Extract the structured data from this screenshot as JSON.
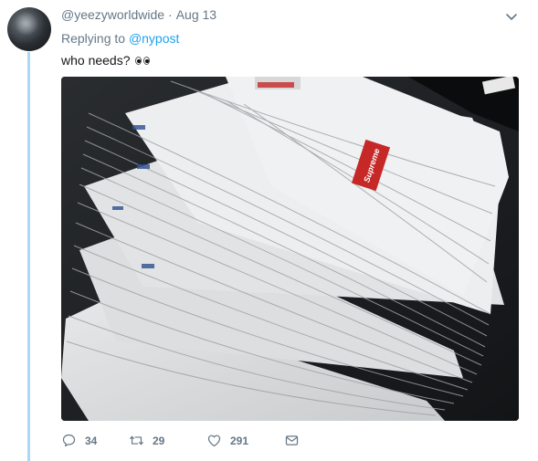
{
  "tweet": {
    "handle": "@yeezyworldwide",
    "separator": "·",
    "date": "Aug 13",
    "replying_to_prefix": "Replying to",
    "replying_to_user": "@nypost",
    "text": "who needs?",
    "emoji": "eyes-emoji"
  },
  "media": {
    "description_icon": "newspaper-stack-photo",
    "logo_text": "Supreme"
  },
  "actions": {
    "replies": "34",
    "retweets": "29",
    "likes": "291"
  },
  "colors": {
    "link": "#1da1f2",
    "muted": "#657786",
    "thread": "#a9d9f7",
    "brand_red": "#d32f2f"
  }
}
